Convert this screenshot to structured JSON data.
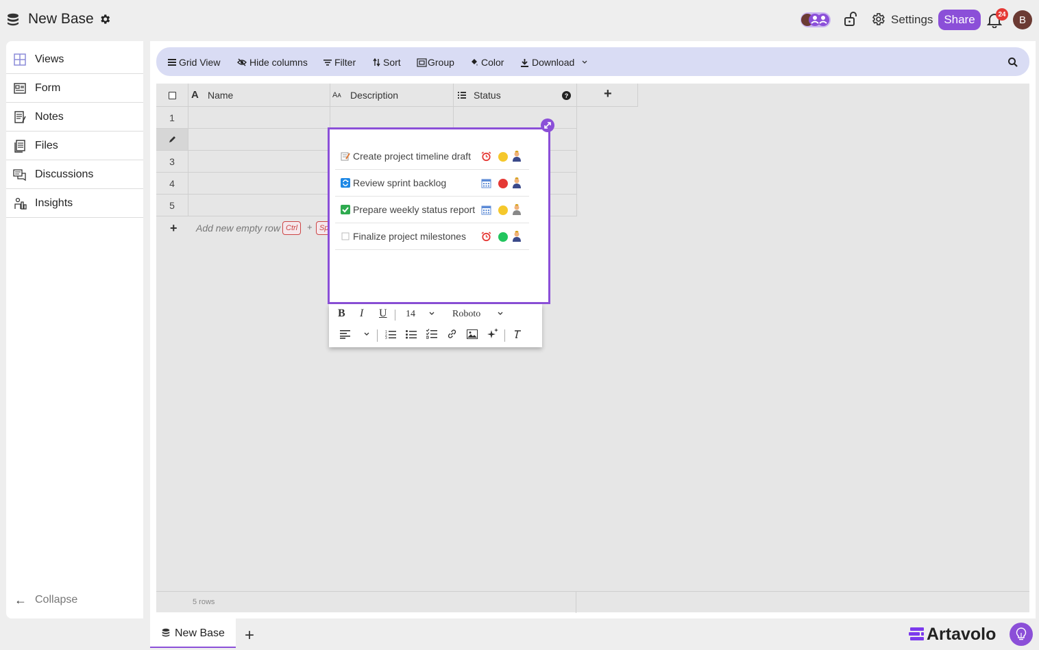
{
  "header": {
    "title": "New Base",
    "settings_label": "Settings",
    "share_label": "Share",
    "notification_count": "24",
    "user_initial": "B",
    "collaborator_initial": "B"
  },
  "sidebar": {
    "items": [
      {
        "label": "Views",
        "icon": "grid-icon"
      },
      {
        "label": "Form",
        "icon": "form-icon"
      },
      {
        "label": "Notes",
        "icon": "notes-icon"
      },
      {
        "label": "Files",
        "icon": "files-icon"
      },
      {
        "label": "Discussions",
        "icon": "discussions-icon"
      },
      {
        "label": "Insights",
        "icon": "insights-icon"
      }
    ],
    "collapse_label": "Collapse"
  },
  "toolbar": {
    "grid_view": "Grid View",
    "hide_columns": "Hide columns",
    "filter": "Filter",
    "sort": "Sort",
    "group": "Group",
    "color": "Color",
    "download": "Download"
  },
  "grid": {
    "columns": [
      "Name",
      "Description",
      "Status"
    ],
    "add_column": "+",
    "rows": [
      "1",
      "",
      "3",
      "4",
      "5"
    ],
    "add_row_label": "Add new empty row",
    "shortcut_ctrl": "Ctrl",
    "shortcut_plus": "+",
    "shortcut_key": "Sp",
    "row_count": "5 rows"
  },
  "editor": {
    "tasks": [
      {
        "text": "Create project timeline draft",
        "status_icon": "memo-icon",
        "date_icon": "alarm-clock-icon",
        "dot_color": "#f5c82c"
      },
      {
        "text": "Review sprint backlog",
        "status_icon": "repeat-icon",
        "date_icon": "calendar-icon",
        "dot_color": "#e53935"
      },
      {
        "text": "Prepare weekly status report",
        "status_icon": "checkbox-checked-icon",
        "date_icon": "calendar-icon",
        "dot_color": "#f5c82c"
      },
      {
        "text": "Finalize project milestones",
        "status_icon": "checkbox-empty-icon",
        "date_icon": "alarm-clock-icon",
        "dot_color": "#22c55e"
      }
    ],
    "format": {
      "bold": "B",
      "italic": "I",
      "underline": "U",
      "font_size": "14",
      "font_family": "Roboto"
    }
  },
  "tabs": {
    "active": "New Base",
    "add": "+"
  },
  "brand": {
    "name": "Artavolo",
    "accent": "#8b4fd8"
  }
}
